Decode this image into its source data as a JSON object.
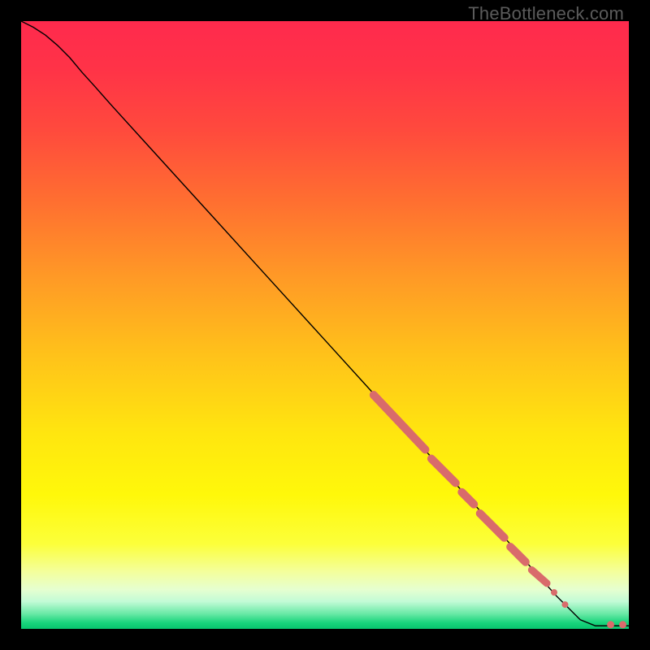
{
  "watermark": "TheBottleneck.com",
  "chart_data": {
    "type": "line",
    "title": "",
    "xlabel": "",
    "ylabel": "",
    "xlim": [
      0,
      100
    ],
    "ylim": [
      0,
      100
    ],
    "background_gradient": {
      "stops": [
        {
          "offset": 0.0,
          "color": "#ff2a4d"
        },
        {
          "offset": 0.08,
          "color": "#ff3347"
        },
        {
          "offset": 0.18,
          "color": "#ff4a3d"
        },
        {
          "offset": 0.3,
          "color": "#ff7030"
        },
        {
          "offset": 0.42,
          "color": "#ff9926"
        },
        {
          "offset": 0.55,
          "color": "#ffc21a"
        },
        {
          "offset": 0.68,
          "color": "#ffe60f"
        },
        {
          "offset": 0.78,
          "color": "#fff80a"
        },
        {
          "offset": 0.86,
          "color": "#fcff3a"
        },
        {
          "offset": 0.905,
          "color": "#f4ff9a"
        },
        {
          "offset": 0.935,
          "color": "#e6ffd0"
        },
        {
          "offset": 0.955,
          "color": "#c2fbd6"
        },
        {
          "offset": 0.975,
          "color": "#6ae9a6"
        },
        {
          "offset": 0.99,
          "color": "#18d47c"
        },
        {
          "offset": 1.0,
          "color": "#08c46e"
        }
      ]
    },
    "series": [
      {
        "name": "curve",
        "stroke": "#000000",
        "stroke_width": 1.4,
        "points": [
          {
            "x": 0.0,
            "y": 100.0
          },
          {
            "x": 2.0,
            "y": 99.0
          },
          {
            "x": 4.0,
            "y": 97.7
          },
          {
            "x": 6.0,
            "y": 96.0
          },
          {
            "x": 8.0,
            "y": 94.0
          },
          {
            "x": 10.0,
            "y": 91.6
          },
          {
            "x": 12.0,
            "y": 89.4
          },
          {
            "x": 15.0,
            "y": 86.0
          },
          {
            "x": 20.0,
            "y": 80.5
          },
          {
            "x": 30.0,
            "y": 69.5
          },
          {
            "x": 40.0,
            "y": 58.5
          },
          {
            "x": 50.0,
            "y": 47.5
          },
          {
            "x": 60.0,
            "y": 36.5
          },
          {
            "x": 70.0,
            "y": 25.5
          },
          {
            "x": 80.0,
            "y": 14.5
          },
          {
            "x": 88.0,
            "y": 5.5
          },
          {
            "x": 92.0,
            "y": 1.5
          },
          {
            "x": 94.5,
            "y": 0.5
          },
          {
            "x": 96.0,
            "y": 0.5
          },
          {
            "x": 98.0,
            "y": 0.5
          },
          {
            "x": 100.0,
            "y": 0.5
          }
        ]
      }
    ],
    "markers": {
      "color": "#d96b6b",
      "segments": [
        {
          "x0": 58.0,
          "y0": 38.5,
          "x1": 66.5,
          "y1": 29.5,
          "thickness": 10
        },
        {
          "x0": 67.5,
          "y0": 28.0,
          "x1": 71.5,
          "y1": 24.0,
          "thickness": 10
        },
        {
          "x0": 72.5,
          "y0": 22.5,
          "x1": 74.5,
          "y1": 20.5,
          "thickness": 10
        },
        {
          "x0": 75.5,
          "y0": 19.0,
          "x1": 79.5,
          "y1": 15.0,
          "thickness": 10
        },
        {
          "x0": 80.5,
          "y0": 13.5,
          "x1": 83.0,
          "y1": 11.0,
          "thickness": 10
        },
        {
          "x0": 84.0,
          "y0": 9.7,
          "x1": 86.5,
          "y1": 7.5,
          "thickness": 9
        }
      ],
      "dots": [
        {
          "x": 87.7,
          "y": 6.0,
          "r": 4.0
        },
        {
          "x": 89.5,
          "y": 4.0,
          "r": 4.0
        },
        {
          "x": 97.0,
          "y": 0.7,
          "r": 4.5
        },
        {
          "x": 99.0,
          "y": 0.7,
          "r": 4.5
        }
      ]
    }
  }
}
